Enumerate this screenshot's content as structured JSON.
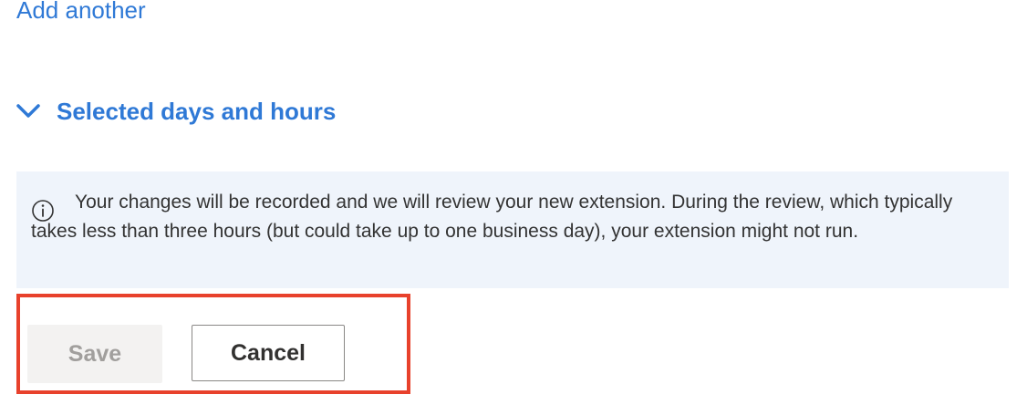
{
  "links": {
    "add_another": "Add another"
  },
  "section": {
    "label": "Selected days and hours",
    "icon": "chevron-down-icon"
  },
  "info": {
    "icon": "info-icon",
    "message": "Your changes will be recorded and we will review your new extension. During the review, which typically takes less than three hours (but could take up to one business day), your extension might not run."
  },
  "actions": {
    "save_label": "Save",
    "save_disabled": true,
    "cancel_label": "Cancel"
  },
  "colors": {
    "link": "#2f79d6",
    "info_background": "#eff4fb",
    "highlight_border": "#e8412c",
    "disabled_button_bg": "#f3f2f1",
    "disabled_button_text": "#a19f9d"
  }
}
